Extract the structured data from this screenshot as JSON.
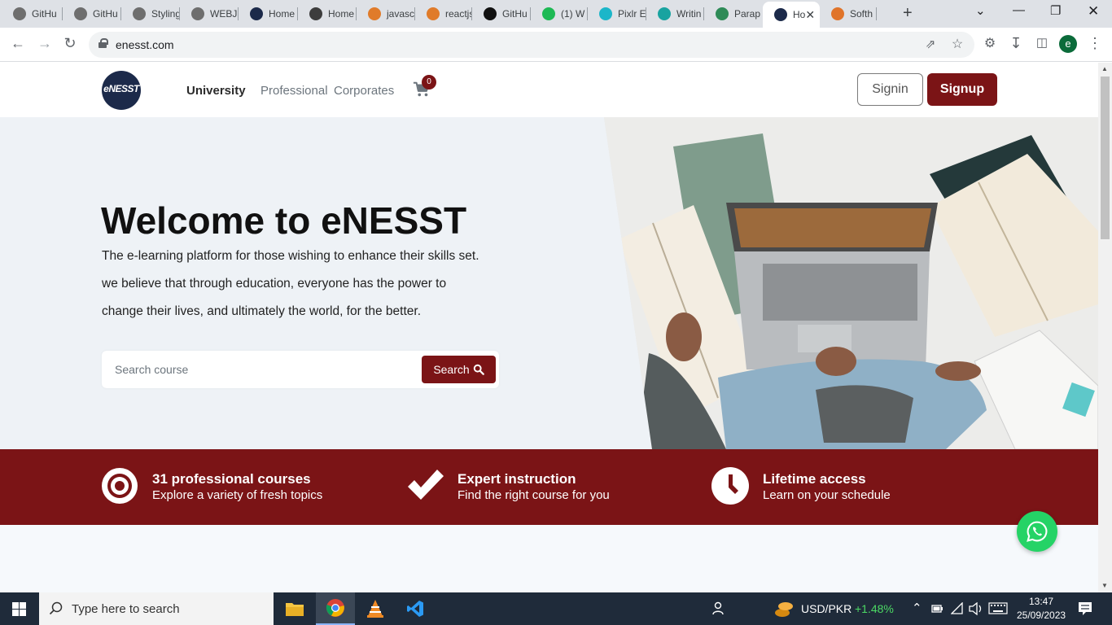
{
  "browser": {
    "tabs": [
      {
        "title": "GitHu",
        "color": "#6e6e6e"
      },
      {
        "title": "GitHu",
        "color": "#6e6e6e"
      },
      {
        "title": "Styling",
        "color": "#6e6e6e"
      },
      {
        "title": "WEBJU",
        "color": "#6e6e6e"
      },
      {
        "title": "Home",
        "color": "#1c2a4a"
      },
      {
        "title": "Home",
        "color": "#3d3d3d"
      },
      {
        "title": "javasc",
        "color": "#e07b2a"
      },
      {
        "title": "reactjs",
        "color": "#e07b2a"
      },
      {
        "title": "GitHu",
        "color": "#111111"
      },
      {
        "title": "(1) W",
        "color": "#1db954"
      },
      {
        "title": "Pixlr E",
        "color": "#1bb6c9"
      },
      {
        "title": "Writin",
        "color": "#19a3a0"
      },
      {
        "title": "Parap",
        "color": "#2e8b57"
      },
      {
        "title": "Ho",
        "color": "#1c2a4a"
      },
      {
        "title": "Softh",
        "color": "#e0742a"
      }
    ],
    "url": "enesst.com",
    "profile_initial": "e"
  },
  "site": {
    "logo_text": "eNESST",
    "nav": {
      "university": "University",
      "professional": "Professional",
      "corporates": "Corporates"
    },
    "cart_count": "0",
    "signin": "Signin",
    "signup": "Signup",
    "accent": "#7b1416"
  },
  "hero": {
    "title": "Welcome to eNESST",
    "lines": [
      "The e-learning platform for those wishing to enhance their skills set.",
      "we believe that through education, everyone has the power to",
      "change their lives, and ultimately the world, for the better."
    ],
    "search_placeholder": "Search course",
    "search_button": "Search"
  },
  "features": [
    {
      "icon": "target-icon",
      "title": "31 professional courses",
      "subtitle": "Explore a variety of fresh topics"
    },
    {
      "icon": "checkmark-icon",
      "title": "Expert instruction",
      "subtitle": "Find the right course for you"
    },
    {
      "icon": "clock-icon",
      "title": "Lifetime access",
      "subtitle": "Learn on your schedule"
    }
  ],
  "taskbar": {
    "search_placeholder": "Type here to search",
    "currency": "USD/PKR",
    "currency_change": "+1.48%",
    "time": "13:47",
    "date": "25/09/2023"
  }
}
